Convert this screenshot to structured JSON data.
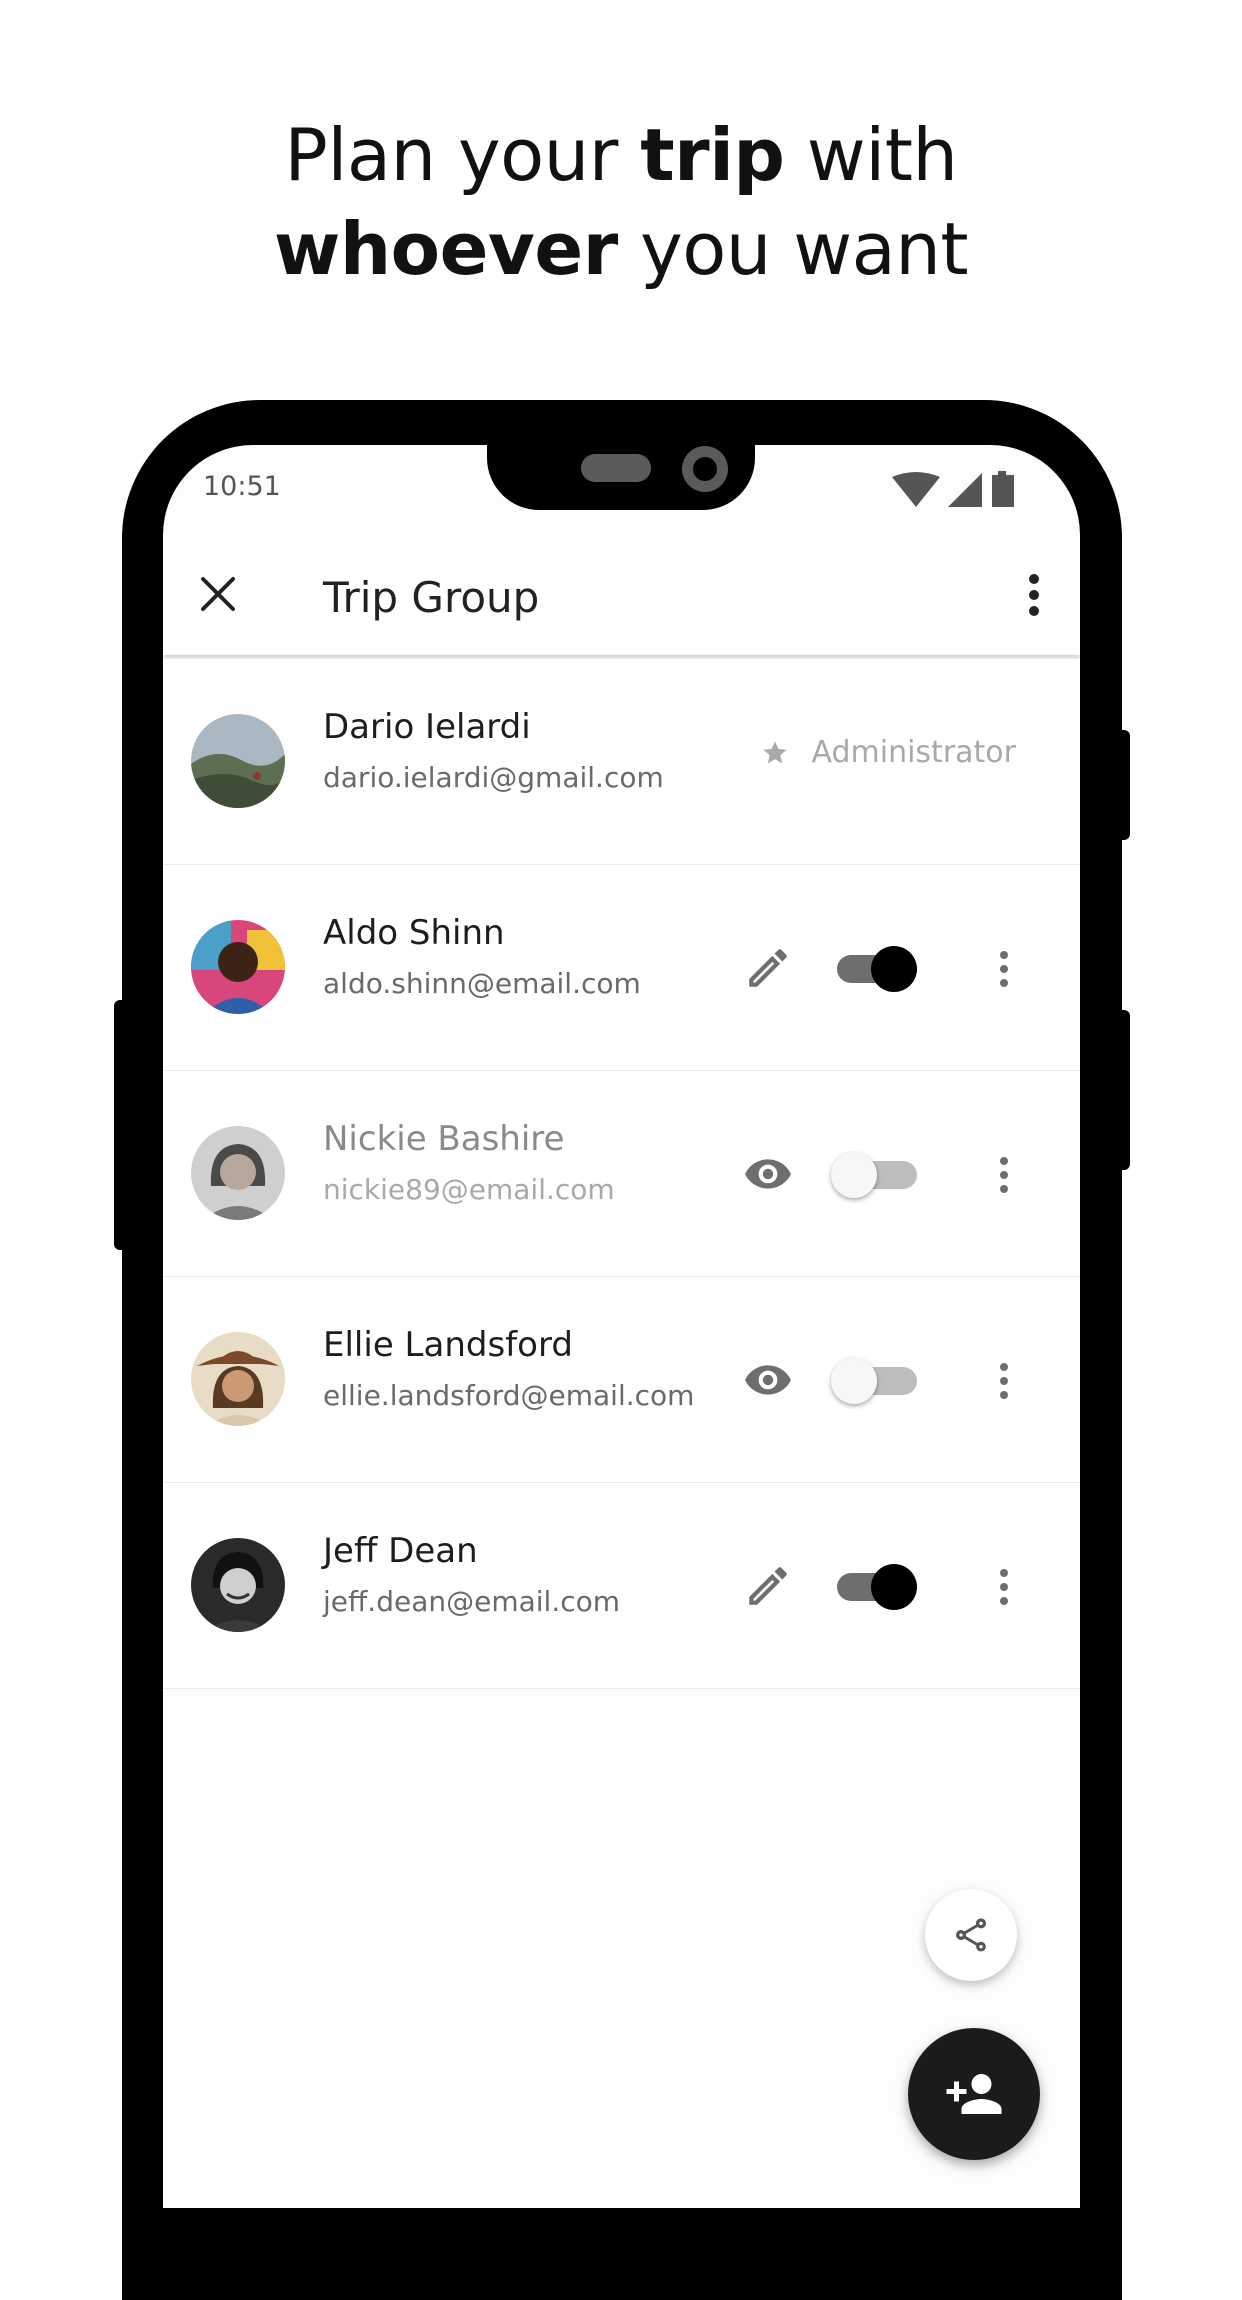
{
  "headline": {
    "line1_part1": "Plan your ",
    "line1_bold": "trip",
    "line1_part2": " with",
    "line2_bold": "whoever",
    "line2_part2": " you want"
  },
  "status_bar": {
    "time": "10:51",
    "icons": [
      "wifi-icon",
      "signal-icon",
      "battery-icon"
    ]
  },
  "app_bar": {
    "title": "Trip Group",
    "left_icon": "close-icon",
    "right_icon": "more-vert-icon"
  },
  "members": [
    {
      "name": "Dario Ielardi",
      "email": "dario.ielardi@gmail.com",
      "role": "Administrator",
      "role_icon": "star-icon"
    },
    {
      "name": "Aldo Shinn",
      "email": "aldo.shinn@email.com",
      "permission_icon": "pencil-icon",
      "enabled": true
    },
    {
      "name": "Nickie Bashire",
      "email": "nickie89@email.com",
      "permission_icon": "eye-icon",
      "enabled": false
    },
    {
      "name": "Ellie Landsford",
      "email": "ellie.landsford@email.com",
      "permission_icon": "eye-icon",
      "enabled": false
    },
    {
      "name": "Jeff Dean",
      "email": "jeff.dean@email.com",
      "permission_icon": "pencil-icon",
      "enabled": true
    }
  ],
  "fabs": {
    "share_icon": "share-icon",
    "add_icon": "person-add-icon"
  },
  "colors": {
    "accent": "#000000",
    "fab_dark": "#1b1b1b",
    "muted_text": "#a9a9a9"
  }
}
